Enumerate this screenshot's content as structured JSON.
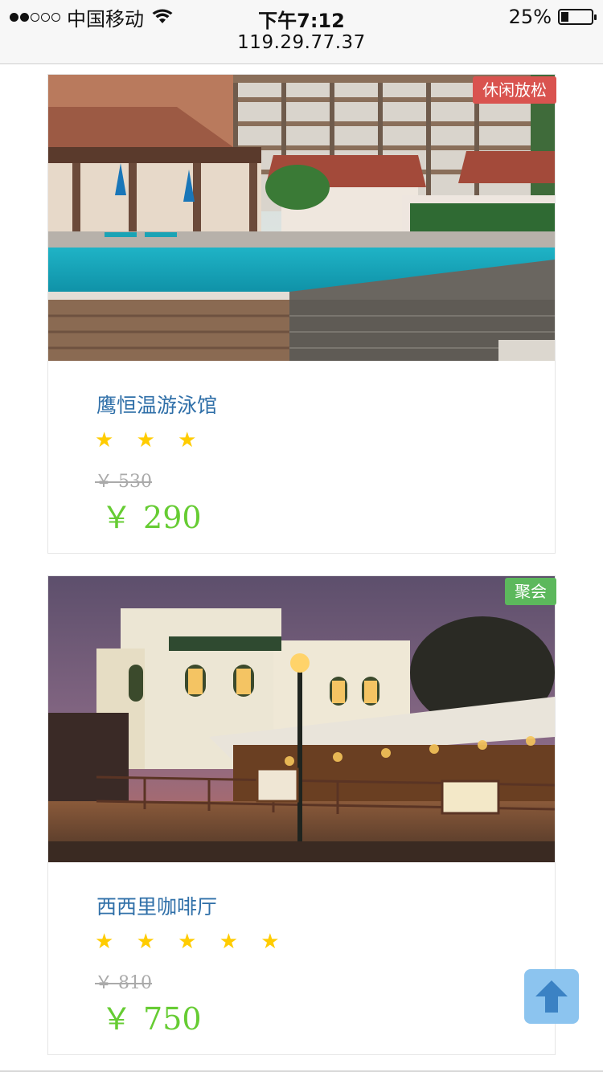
{
  "status_bar": {
    "carrier": "中国移动",
    "time": "下午7:12",
    "battery": "25%",
    "battery_level": 0.25,
    "signal_strength": 2,
    "signal_max": 5,
    "url": "119.29.77.37"
  },
  "items": [
    {
      "tag": "休闲放松",
      "tag_color": "#d9534f",
      "name": "鹰恒温游泳馆",
      "rating": 3,
      "stars": "★ ★ ★",
      "original_price": "￥ 530",
      "price_symbol": "￥",
      "price": "290"
    },
    {
      "tag": "聚会",
      "tag_color": "#5cb85c",
      "name": "西西里咖啡厅",
      "rating": 5,
      "stars": "★ ★ ★ ★ ★",
      "original_price": "￥ 810",
      "price_symbol": "￥",
      "price": "750"
    }
  ],
  "icons": {
    "back_to_top": "arrow-up-icon",
    "wifi": "wifi-icon",
    "battery": "battery-icon"
  },
  "colors": {
    "price": "#66cc33",
    "name": "#2f6fa8",
    "star": "#ffcc00",
    "back_to_top": "#8cc4ef"
  }
}
